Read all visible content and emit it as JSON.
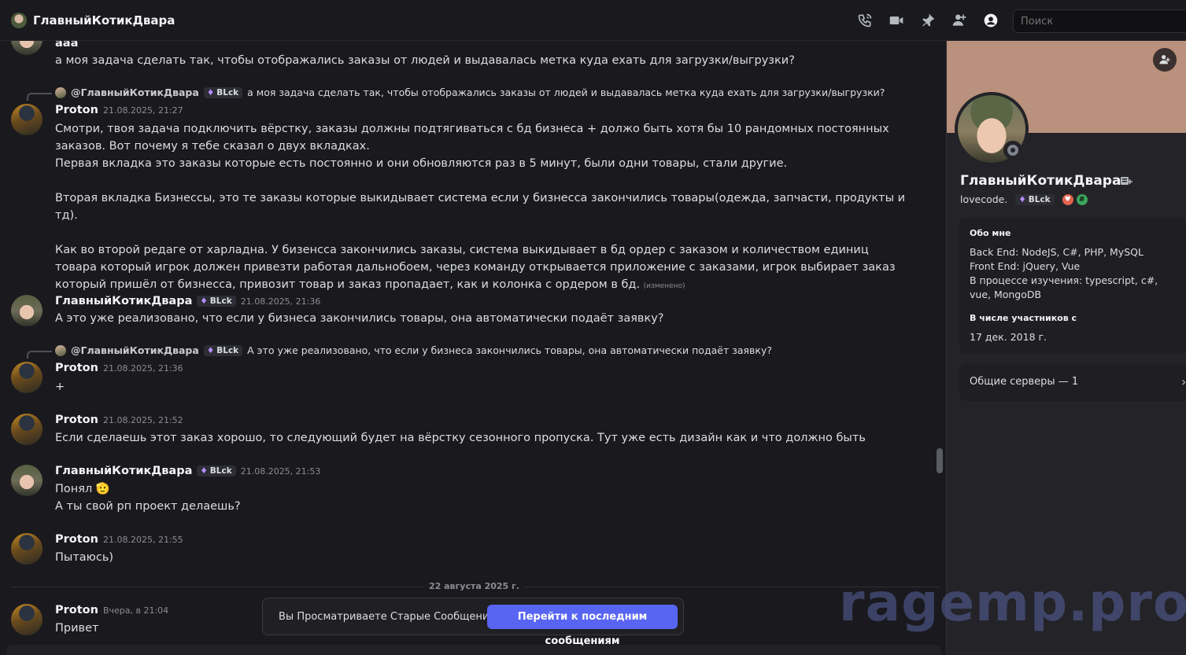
{
  "header": {
    "title": "ГлавныйКотикДвара",
    "search_placeholder": "Поиск"
  },
  "messages": {
    "m0_cut_text": "aaa",
    "m0_text": "а моя задача сделать так, чтобы отображались заказы от людей и выдавалась метка куда ехать для загрузки/выгрузки?",
    "r1_name": "@ГлавныйКотикДвара",
    "r1_badge": "BLck",
    "r1_text": "а моя задача сделать так, чтобы отображались заказы от людей и выдавалась метка куда ехать для загрузки/выгрузки?",
    "m1_name": "Proton",
    "m1_time": "21.08.2025, 21:27",
    "m1_p1": "Смотри, твоя задача подключить вёрстку, заказы должны подтягиваться с бд бизнеса + должо  быть хотя бы 10 рандомных постоянных заказов. Вот почему я тебе сказал о двух вкладках.",
    "m1_p2": "Первая вкладка это заказы которые есть постоянно и они обновляются раз в 5 минут, были одни товары, стали другие.",
    "m1_p3": "Вторая вкладка Бизнессы, это те заказы которые выкидывает система если у бизнесса закончились товары(одежда, запчасти, продукты и тд).",
    "m1_p4": "Как во второй редаге от харладна. У бизенсса закончились заказы, система выкидывает в бд ордер с заказом и количеством единиц товара который игрок должен привезти работая дальнобоем, через команду открывается приложение с заказами, игрок выбирает заказ который пришёл от бизнесса, привозит товар и заказ пропадает, как и колонка с ордером в бд.",
    "m1_edited": "(изменено)",
    "m2_name": "ГлавныйКотикДвара",
    "m2_badge": "BLck",
    "m2_time": "21.08.2025, 21:36",
    "m2_text": "А это уже реализовано, что если у бизнеса закончились товары, она автоматически подаёт заявку?",
    "r3_name": "@ГлавныйКотикДвара",
    "r3_badge": "BLck",
    "r3_text": "А это уже реализовано, что если у бизнеса закончились товары, она автоматически подаёт заявку?",
    "m3_name": "Proton",
    "m3_time": "21.08.2025, 21:36",
    "m3_text": "+",
    "m4_name": "Proton",
    "m4_time": "21.08.2025, 21:52",
    "m4_text": "Если сделаешь этот заказ хорошо, то следующий будет на вёрстку сезонного пропуска. Тут уже есть дизайн как и что должно быть",
    "m5_name": "ГлавныйКотикДвара",
    "m5_badge": "BLck",
    "m5_time": "21.08.2025, 21:53",
    "m5_line1": "Понял",
    "m5_emoji": "🫡",
    "m5_line2": "А ты свой рп проект делаешь?",
    "m6_name": "Proton",
    "m6_time": "21.08.2025, 21:55",
    "m6_text": "Пытаюсь)",
    "divider": "22 августа 2025 г.",
    "m7_name": "Proton",
    "m7_time": "Вчера, в 21:04",
    "m7_text": "Привет"
  },
  "toast": {
    "label": "Вы Просматриваете Старые Сообщения",
    "button": "Перейти к последним сообщениям"
  },
  "profile": {
    "name": "ГлавныйКотикДвара",
    "handle": "lovecode.",
    "badge": "BLck",
    "about_label": "Обо мне",
    "about_lines": [
      "Back End: NodeJS, C#, PHP, MySQL",
      "Front End: jQuery, Vue",
      "В процессе изучения: typescript, c#, vue, MongoDB"
    ],
    "member_since_label": "В числе участников с",
    "member_since": "17 дек. 2018 г.",
    "mutual_servers": "Общие серверы — 1"
  },
  "watermark": "ragemp.pro",
  "colors": {
    "background": "#1a1a1e",
    "panel": "#232328",
    "accent": "#5865f2",
    "banner": "#b9917c"
  }
}
